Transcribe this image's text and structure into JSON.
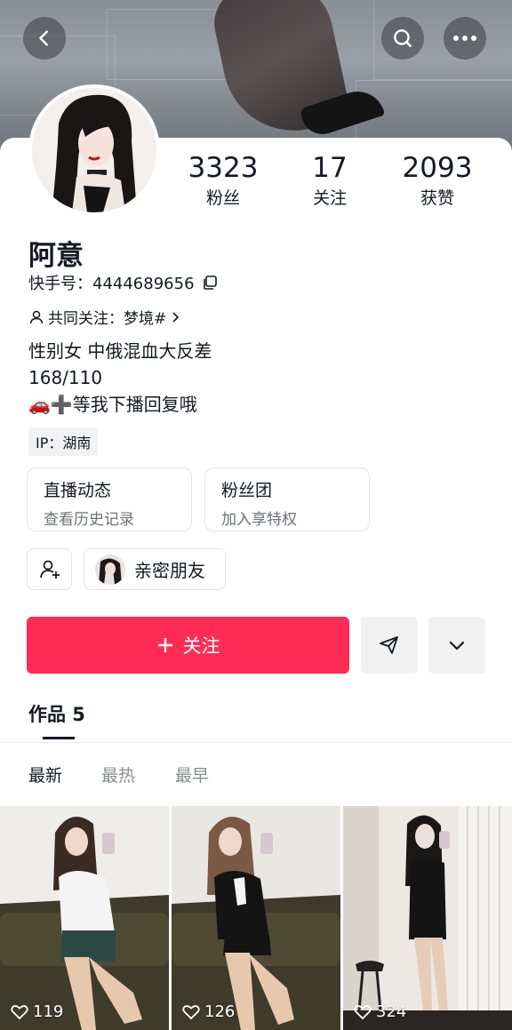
{
  "header": {
    "back_icon": "back-chevron-icon",
    "search_icon": "search-icon",
    "more_icon": "more-dots-icon"
  },
  "stats": [
    {
      "value": "3323",
      "label": "粉丝"
    },
    {
      "value": "17",
      "label": "关注"
    },
    {
      "value": "2093",
      "label": "获赞"
    }
  ],
  "profile": {
    "name": "阿意",
    "kuaishou_id": "快手号：4444689656",
    "mutual": "共同关注：梦境#",
    "bio": [
      "性别女 中俄混血大反差",
      "168/110",
      "🚗➕等我下播回复哦"
    ],
    "ip": "IP：湖南"
  },
  "cards": [
    {
      "title": "直播动态",
      "subtitle": "查看历史记录"
    },
    {
      "title": "粉丝团",
      "subtitle": "加入享特权"
    }
  ],
  "intimate_friends_label": "亲密朋友",
  "actions": {
    "follow_label": "关注"
  },
  "works": {
    "tab_label": "作品 5"
  },
  "sort_tabs": [
    "最新",
    "最热",
    "最早"
  ],
  "videos": [
    {
      "likes": "119"
    },
    {
      "likes": "126"
    },
    {
      "likes": "324"
    }
  ],
  "colors": {
    "accent": "#fe2c55",
    "text": "#161823",
    "muted": "#70717a"
  }
}
